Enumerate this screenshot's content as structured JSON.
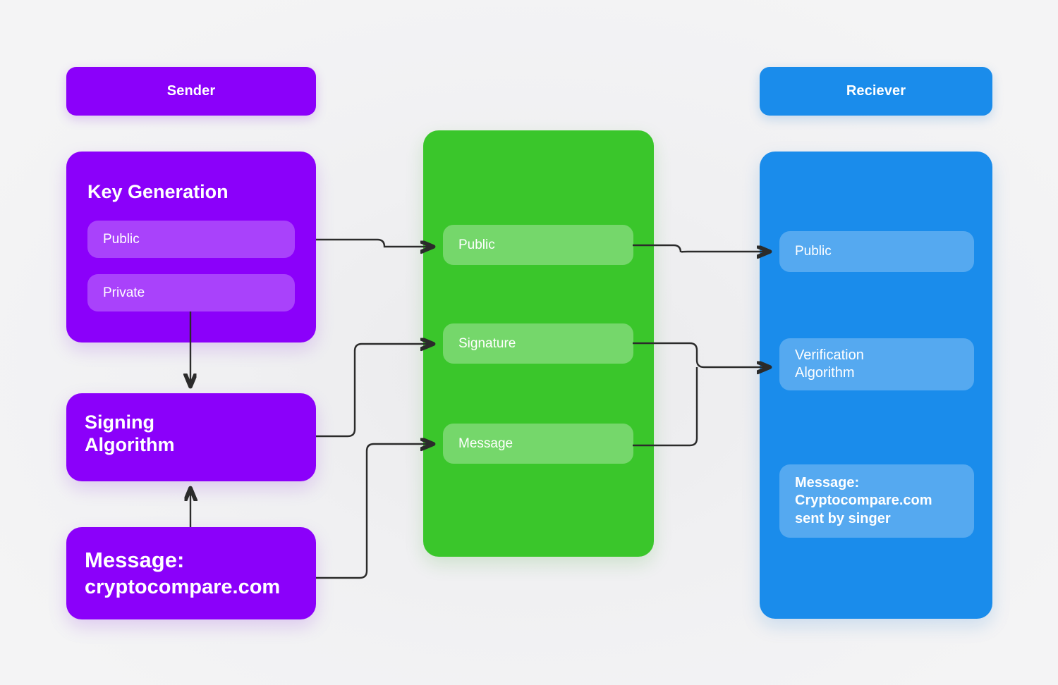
{
  "columns": {
    "sender": {
      "header": "Sender"
    },
    "receiver": {
      "header": "Reciever"
    }
  },
  "sender": {
    "key_generation": {
      "title": "Key Generation",
      "public_label": "Public",
      "private_label": "Private"
    },
    "signing": {
      "title": "Signing\nAlgorithm"
    },
    "message": {
      "title": "Message:",
      "value": "cryptocompare.com"
    }
  },
  "channel": {
    "public_label": "Public",
    "signature_label": "Signature",
    "message_label": "Message"
  },
  "receiver": {
    "public_label": "Public",
    "verification_label": "Verification\nAlgorithm",
    "message_label": "Message:\nCryptocompare.com\nsent by singer"
  },
  "colors": {
    "sender_purple": "#8b00fa",
    "channel_green": "#3ac62b",
    "receiver_blue": "#1a8ceb",
    "background": "#f3f3f4",
    "connector": "#2b2b2b",
    "text": "#ffffff"
  },
  "flow": [
    {
      "from": "sender.key_generation.public",
      "to": "channel.public",
      "arrow": "right"
    },
    {
      "from": "channel.public",
      "to": "receiver.public",
      "arrow": "right"
    },
    {
      "from": "sender.key_generation.private",
      "to": "sender.signing",
      "arrow": "down"
    },
    {
      "from": "sender.message",
      "to": "sender.signing",
      "arrow": "up"
    },
    {
      "from": "sender.signing",
      "to": "channel.signature",
      "arrow": "right"
    },
    {
      "from": "sender.message",
      "to": "channel.message",
      "arrow": "right"
    },
    {
      "from": "channel.signature",
      "to": "receiver.verification",
      "arrow": "right"
    },
    {
      "from": "channel.message",
      "to": "receiver.verification",
      "arrow": "right"
    }
  ]
}
